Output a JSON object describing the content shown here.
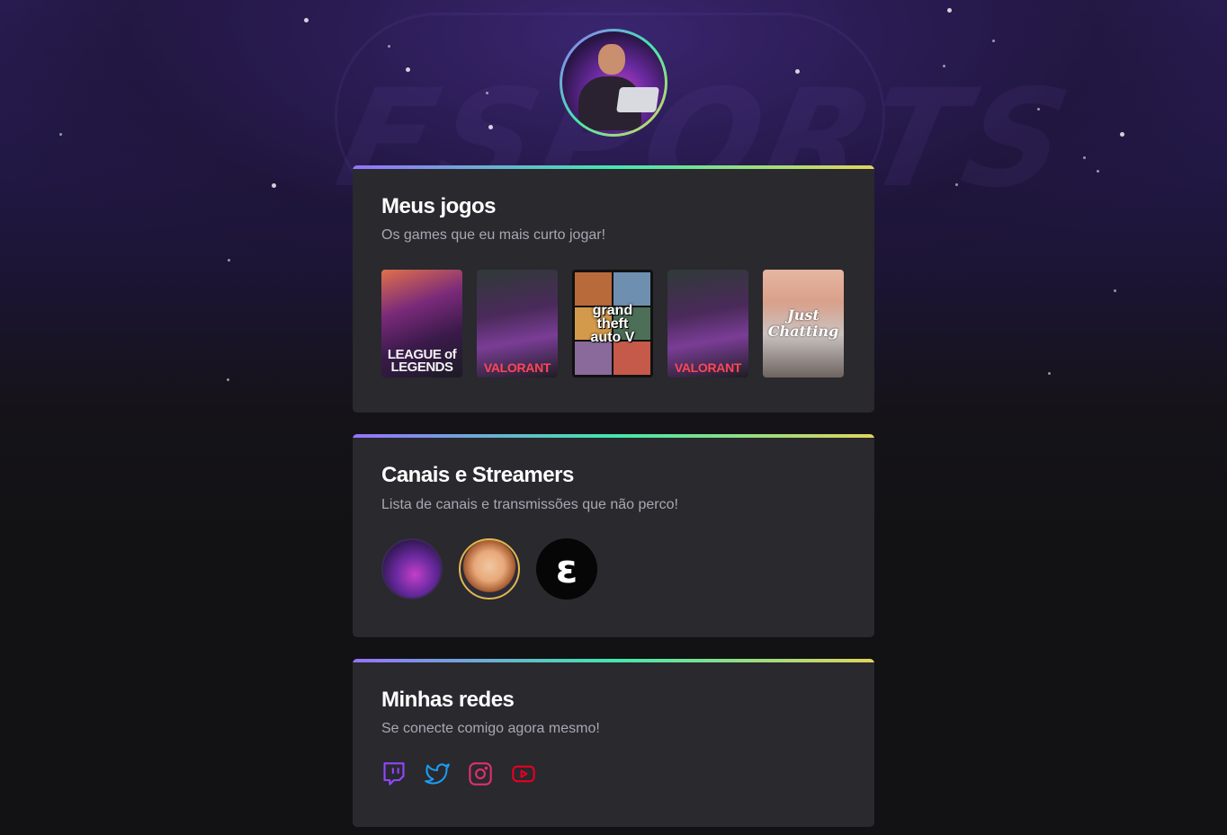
{
  "colors": {
    "background": "#121214",
    "card": "#29292e",
    "gradient": [
      "#9572fc",
      "#43e7ad",
      "#e2d45c"
    ],
    "title": "#ffffff",
    "subtitle": "#a8a8b3",
    "twitch": "#9147ff",
    "twitter": "#1d9bf0",
    "instagram": "#e1306c",
    "youtube": "#ff0000"
  },
  "profile": {
    "avatar_icon": "profile-avatar"
  },
  "games_section": {
    "title": "Meus jogos",
    "subtitle": "Os games que eu mais curto jogar!",
    "games": [
      {
        "name": "League of Legends",
        "label": "LEAGUE of\nLEGENDS"
      },
      {
        "name": "Valorant",
        "label": "VALORANT"
      },
      {
        "name": "Grand Theft Auto V",
        "label": "grand\ntheft\nauto V"
      },
      {
        "name": "Valorant",
        "label": "VALORANT"
      },
      {
        "name": "Just Chatting",
        "label": "Just\nChatting"
      }
    ]
  },
  "streamers_section": {
    "title": "Canais e Streamers",
    "subtitle": "Lista de canais e transmissões que não perco!",
    "streamers": [
      {
        "icon": "streamer-avatar-1"
      },
      {
        "icon": "streamer-avatar-2"
      },
      {
        "icon": "streamer-avatar-3"
      }
    ]
  },
  "socials_section": {
    "title": "Minhas redes",
    "subtitle": "Se conecte comigo agora mesmo!",
    "links": [
      {
        "icon": "twitch-icon"
      },
      {
        "icon": "twitter-icon"
      },
      {
        "icon": "instagram-icon"
      },
      {
        "icon": "youtube-icon"
      }
    ]
  }
}
